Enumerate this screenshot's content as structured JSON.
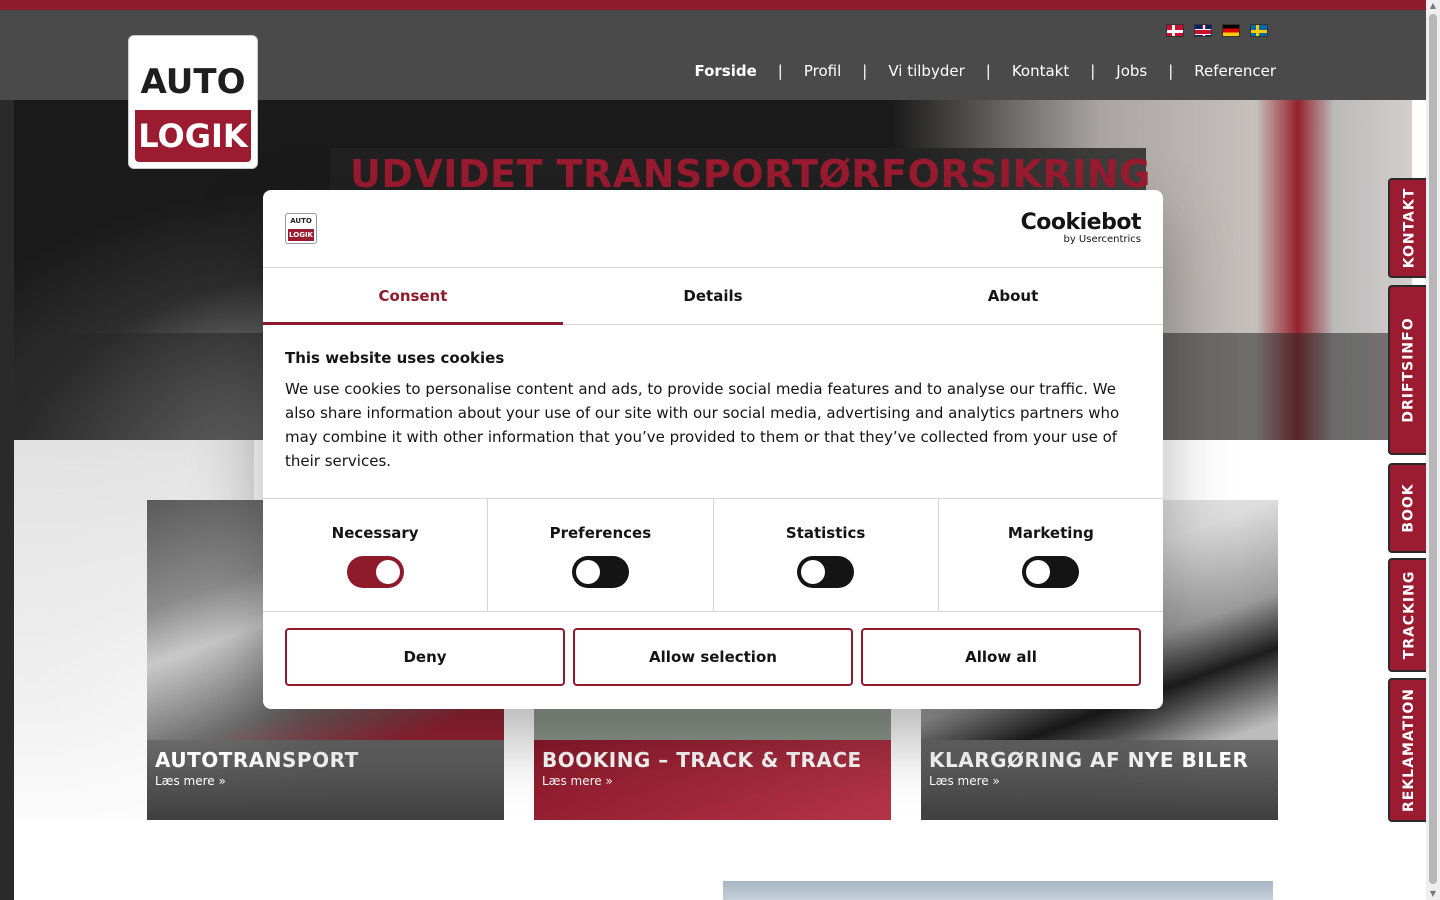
{
  "header": {
    "logo": {
      "top_text": "AUTO",
      "bottom_text": "LOGIK"
    },
    "languages": [
      {
        "code": "da",
        "icon": "flag-dk-icon"
      },
      {
        "code": "en",
        "icon": "flag-gb-icon"
      },
      {
        "code": "de",
        "icon": "flag-de-icon"
      },
      {
        "code": "sv",
        "icon": "flag-se-icon"
      }
    ],
    "nav": [
      "Forside",
      "Profil",
      "Vi tilbyder",
      "Kontakt",
      "Jobs",
      "Referencer"
    ],
    "nav_separator": "|"
  },
  "hero": {
    "title": "UDVIDET TRANSPORTØRFORSIKRING"
  },
  "cards": [
    {
      "title": "AUTOTRANSPORT",
      "more": "Læs mere »"
    },
    {
      "title": "BOOKING – TRACK & TRACE",
      "more": "Læs mere »"
    },
    {
      "title": "KLARGØRING AF NYE BILER",
      "more": "Læs mere »"
    }
  ],
  "side_tabs": [
    "KONTAKT",
    "DRIFTSINFO",
    "BOOK",
    "TRACKING",
    "REKLAMATION"
  ],
  "cookie_dialog": {
    "logo": {
      "top_text": "AUTO",
      "bottom_text": "LOGIK"
    },
    "brand": {
      "name": "Cookiebot",
      "sub": "by Usercentrics"
    },
    "tabs": [
      "Consent",
      "Details",
      "About"
    ],
    "active_tab": "Consent",
    "heading": "This website uses cookies",
    "text": "We use cookies to personalise content and ads, to provide social media features and to analyse our traffic. We also share information about your use of our site with our social media, advertising and analytics partners who may combine it with other information that you’ve provided to them or that they’ve collected from your use of their services.",
    "categories": [
      {
        "label": "Necessary",
        "enabled": true
      },
      {
        "label": "Preferences",
        "enabled": false
      },
      {
        "label": "Statistics",
        "enabled": false
      },
      {
        "label": "Marketing",
        "enabled": false
      }
    ],
    "buttons": {
      "deny": "Deny",
      "allow_selection": "Allow selection",
      "allow_all": "Allow all"
    }
  },
  "colors": {
    "brand_red": "#8e1a2c",
    "header_gray": "#4a4a4a"
  }
}
